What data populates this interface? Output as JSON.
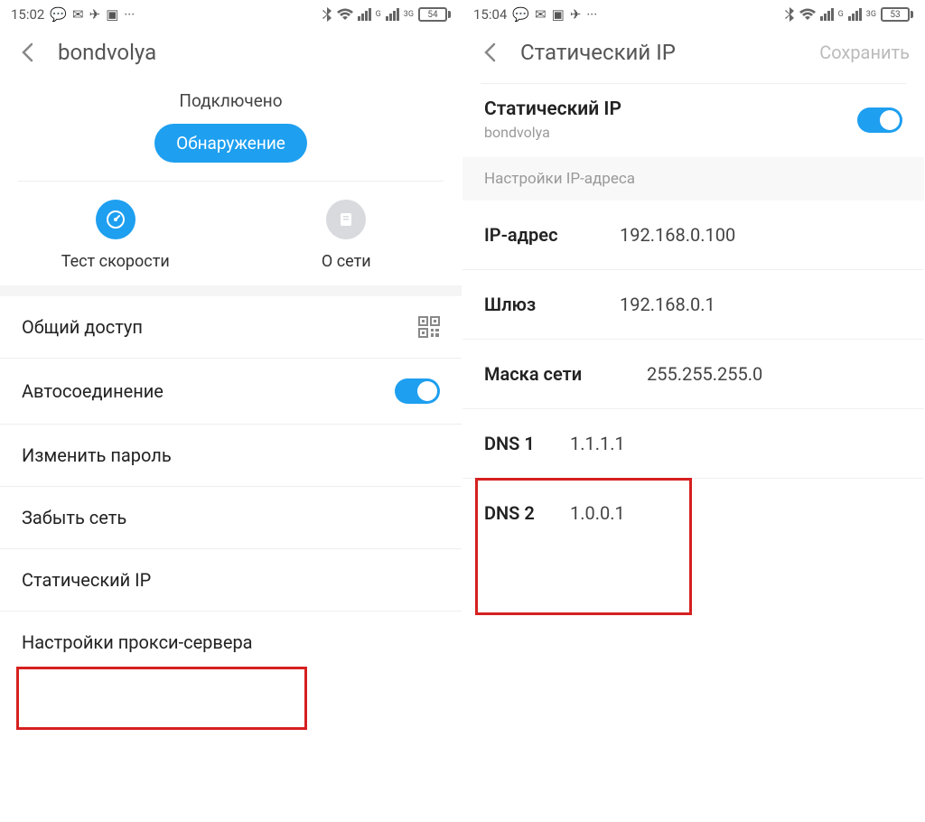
{
  "left": {
    "status": {
      "time": "15:02",
      "battery": "54"
    },
    "header": {
      "title": "bondvolya"
    },
    "connected_label": "Подключено",
    "discover_button": "Обнаружение",
    "speed_test": "Тест скорости",
    "about_network": "О сети",
    "items": {
      "sharing": "Общий доступ",
      "autoconnect": "Автосоединение",
      "change_password": "Изменить пароль",
      "forget_network": "Забыть сеть",
      "static_ip": "Статический IP",
      "proxy_settings": "Настройки прокси-сервера"
    }
  },
  "right": {
    "status": {
      "time": "15:04",
      "battery": "53"
    },
    "header": {
      "title": "Статический IP",
      "save": "Сохранить"
    },
    "static_ip_title": "Статический IP",
    "static_ip_sub": "bondvolya",
    "section": "Настройки IP-адреса",
    "rows": {
      "ip_label": "IP-адрес",
      "ip_value": "192.168.0.100",
      "gateway_label": "Шлюз",
      "gateway_value": "192.168.0.1",
      "netmask_label": "Маска сети",
      "netmask_value": "255.255.255.0",
      "dns1_label": "DNS 1",
      "dns1_value": "1.1.1.1",
      "dns2_label": "DNS 2",
      "dns2_value": "1.0.0.1"
    }
  }
}
